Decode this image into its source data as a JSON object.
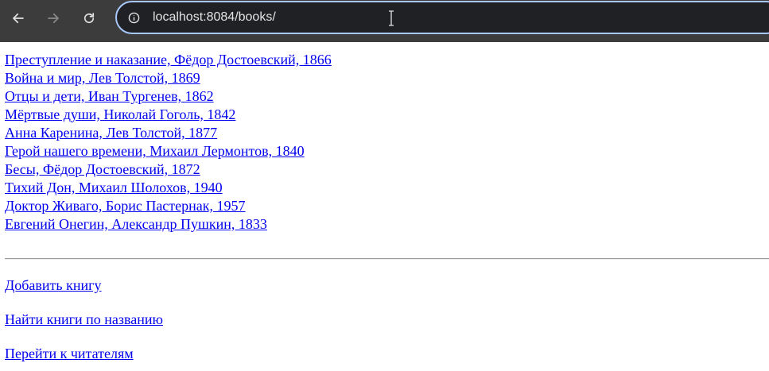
{
  "browser": {
    "url": "localhost:8084/books/",
    "back_icon": "arrow-left-icon",
    "forward_icon": "arrow-right-icon",
    "reload_icon": "reload-icon",
    "site_info_icon": "info-icon"
  },
  "books": [
    "Преступление и наказание, Фёдор Достоевский, 1866",
    "Война и мир, Лев Толстой, 1869",
    "Отцы и дети, Иван Тургенев, 1862",
    "Мёртвые души, Николай Гоголь, 1842",
    "Анна Каренина, Лев Толстой, 1877",
    "Герой нашего времени, Михаил Лермонтов, 1840",
    "Бесы, Фёдор Достоевский, 1872",
    "Тихий Дон, Михаил Шолохов, 1940",
    "Доктор Живаго, Борис Пастернак, 1957",
    "Евгений Онегин, Александр Пушкин, 1833"
  ],
  "actions": {
    "add_book": "Добавить книгу",
    "find_books": "Найти книги по названию",
    "go_readers": "Перейти к читателям"
  },
  "colors": {
    "link": "#0000ee",
    "toolbar": "#3c3c3c",
    "omnibox": "#202124",
    "omnibox_border": "#a8c7fa"
  }
}
